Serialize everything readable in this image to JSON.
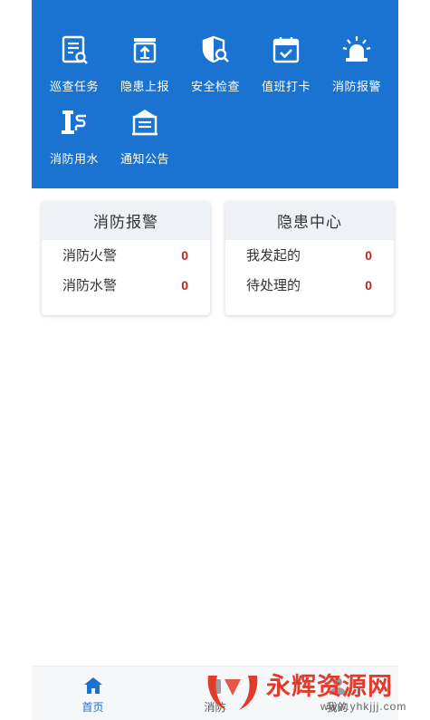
{
  "menu": {
    "items": [
      {
        "label": "巡查任务",
        "icon": "checklist-search-icon"
      },
      {
        "label": "隐患上报",
        "icon": "upload-box-icon"
      },
      {
        "label": "安全检查",
        "icon": "shield-search-icon"
      },
      {
        "label": "值班打卡",
        "icon": "calendar-check-icon"
      },
      {
        "label": "消防报警",
        "icon": "alarm-siren-icon"
      },
      {
        "label": "消防用水",
        "icon": "hydrant-faucet-icon"
      },
      {
        "label": "通知公告",
        "icon": "notice-board-icon"
      }
    ]
  },
  "cards": {
    "alarm": {
      "title": "消防报警",
      "rows": [
        {
          "label": "消防火警",
          "value": "0"
        },
        {
          "label": "消防水警",
          "value": "0"
        }
      ]
    },
    "hazard": {
      "title": "隐患中心",
      "rows": [
        {
          "label": "我发起的",
          "value": "0"
        },
        {
          "label": "待处理的",
          "value": "0"
        }
      ]
    }
  },
  "tabbar": {
    "tabs": [
      {
        "label": "首页",
        "icon": "home-icon",
        "active": true
      },
      {
        "label": "消防",
        "icon": "fire-icon",
        "active": false
      },
      {
        "label": "我的",
        "icon": "user-icon",
        "active": false
      }
    ]
  },
  "watermark": {
    "title": "永辉资源网",
    "url": "www.yhkjjj.com"
  },
  "colors": {
    "primary": "#1a73d0",
    "value_red": "#b8251c",
    "watermark_red": "#e23b2a"
  }
}
